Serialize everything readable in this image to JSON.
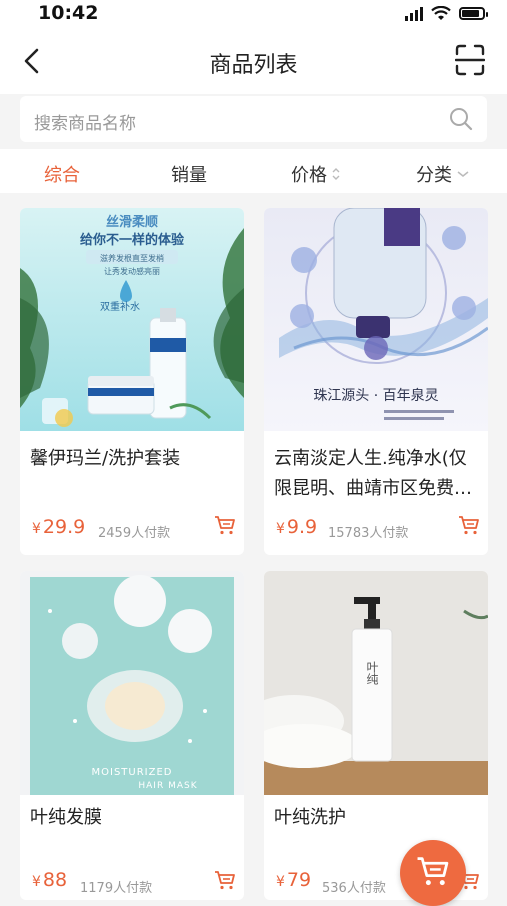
{
  "status": {
    "time": "10:42"
  },
  "nav": {
    "title": "商品列表"
  },
  "search": {
    "placeholder": "搜索商品名称"
  },
  "filters": [
    {
      "label": "综合",
      "active": true
    },
    {
      "label": "销量"
    },
    {
      "label": "价格"
    },
    {
      "label": "分类"
    }
  ],
  "products": [
    {
      "title": "馨伊玛兰/洗护套装",
      "price": "29.9",
      "sold": "2459人付款",
      "image_text": {
        "top": "丝滑柔顺",
        "line1": "给你不一样的体验",
        "line2": "滋养发根直至发梢",
        "line3": "让秀发动感亮丽",
        "badge": "双重补水"
      }
    },
    {
      "title": "云南淡定人生.纯净水(仅限昆明、曲靖市区免费…",
      "price": "9.9",
      "sold": "15783人付款",
      "image_text": {
        "caption": "珠江源头 · 百年泉灵"
      }
    },
    {
      "title": "叶纯发膜",
      "price": "88",
      "sold": "1179人付款",
      "image_text": {
        "caption1": "MOISTURIZED",
        "caption2": "HAIR MASK"
      }
    },
    {
      "title": "叶纯洗护",
      "price": "79",
      "sold": "536人付款",
      "image_text": {
        "brand": "叶纯"
      }
    }
  ],
  "currency": "¥",
  "colors": {
    "accent": "#e8623a",
    "bg": "#f4f4f4"
  },
  "icons": [
    "back-arrow-icon",
    "scan-icon",
    "search-icon",
    "sort-arrows-icon",
    "chevron-down-icon",
    "cart-icon"
  ]
}
